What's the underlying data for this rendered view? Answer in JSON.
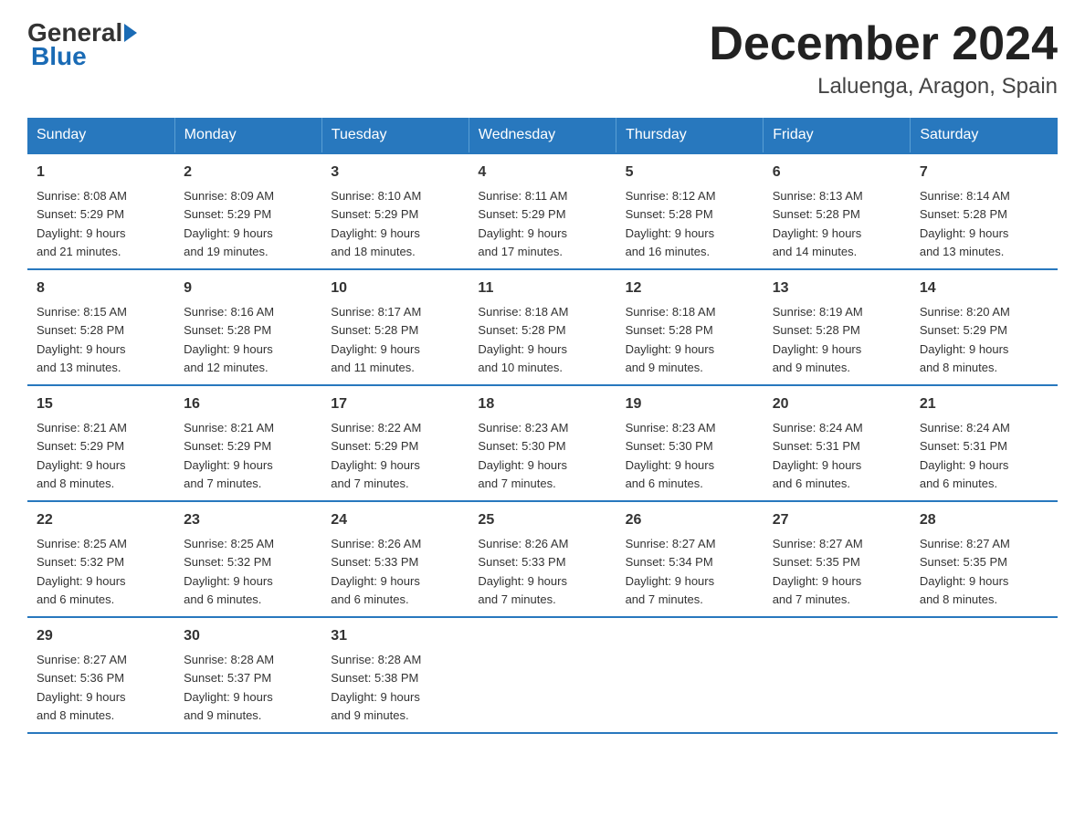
{
  "header": {
    "logo_general": "General",
    "logo_blue": "Blue",
    "month_title": "December 2024",
    "location": "Laluenga, Aragon, Spain"
  },
  "days_of_week": [
    "Sunday",
    "Monday",
    "Tuesday",
    "Wednesday",
    "Thursday",
    "Friday",
    "Saturday"
  ],
  "weeks": [
    [
      {
        "day": "1",
        "sunrise": "8:08 AM",
        "sunset": "5:29 PM",
        "daylight": "9 hours and 21 minutes."
      },
      {
        "day": "2",
        "sunrise": "8:09 AM",
        "sunset": "5:29 PM",
        "daylight": "9 hours and 19 minutes."
      },
      {
        "day": "3",
        "sunrise": "8:10 AM",
        "sunset": "5:29 PM",
        "daylight": "9 hours and 18 minutes."
      },
      {
        "day": "4",
        "sunrise": "8:11 AM",
        "sunset": "5:29 PM",
        "daylight": "9 hours and 17 minutes."
      },
      {
        "day": "5",
        "sunrise": "8:12 AM",
        "sunset": "5:28 PM",
        "daylight": "9 hours and 16 minutes."
      },
      {
        "day": "6",
        "sunrise": "8:13 AM",
        "sunset": "5:28 PM",
        "daylight": "9 hours and 14 minutes."
      },
      {
        "day": "7",
        "sunrise": "8:14 AM",
        "sunset": "5:28 PM",
        "daylight": "9 hours and 13 minutes."
      }
    ],
    [
      {
        "day": "8",
        "sunrise": "8:15 AM",
        "sunset": "5:28 PM",
        "daylight": "9 hours and 13 minutes."
      },
      {
        "day": "9",
        "sunrise": "8:16 AM",
        "sunset": "5:28 PM",
        "daylight": "9 hours and 12 minutes."
      },
      {
        "day": "10",
        "sunrise": "8:17 AM",
        "sunset": "5:28 PM",
        "daylight": "9 hours and 11 minutes."
      },
      {
        "day": "11",
        "sunrise": "8:18 AM",
        "sunset": "5:28 PM",
        "daylight": "9 hours and 10 minutes."
      },
      {
        "day": "12",
        "sunrise": "8:18 AM",
        "sunset": "5:28 PM",
        "daylight": "9 hours and 9 minutes."
      },
      {
        "day": "13",
        "sunrise": "8:19 AM",
        "sunset": "5:28 PM",
        "daylight": "9 hours and 9 minutes."
      },
      {
        "day": "14",
        "sunrise": "8:20 AM",
        "sunset": "5:29 PM",
        "daylight": "9 hours and 8 minutes."
      }
    ],
    [
      {
        "day": "15",
        "sunrise": "8:21 AM",
        "sunset": "5:29 PM",
        "daylight": "9 hours and 8 minutes."
      },
      {
        "day": "16",
        "sunrise": "8:21 AM",
        "sunset": "5:29 PM",
        "daylight": "9 hours and 7 minutes."
      },
      {
        "day": "17",
        "sunrise": "8:22 AM",
        "sunset": "5:29 PM",
        "daylight": "9 hours and 7 minutes."
      },
      {
        "day": "18",
        "sunrise": "8:23 AM",
        "sunset": "5:30 PM",
        "daylight": "9 hours and 7 minutes."
      },
      {
        "day": "19",
        "sunrise": "8:23 AM",
        "sunset": "5:30 PM",
        "daylight": "9 hours and 6 minutes."
      },
      {
        "day": "20",
        "sunrise": "8:24 AM",
        "sunset": "5:31 PM",
        "daylight": "9 hours and 6 minutes."
      },
      {
        "day": "21",
        "sunrise": "8:24 AM",
        "sunset": "5:31 PM",
        "daylight": "9 hours and 6 minutes."
      }
    ],
    [
      {
        "day": "22",
        "sunrise": "8:25 AM",
        "sunset": "5:32 PM",
        "daylight": "9 hours and 6 minutes."
      },
      {
        "day": "23",
        "sunrise": "8:25 AM",
        "sunset": "5:32 PM",
        "daylight": "9 hours and 6 minutes."
      },
      {
        "day": "24",
        "sunrise": "8:26 AM",
        "sunset": "5:33 PM",
        "daylight": "9 hours and 6 minutes."
      },
      {
        "day": "25",
        "sunrise": "8:26 AM",
        "sunset": "5:33 PM",
        "daylight": "9 hours and 7 minutes."
      },
      {
        "day": "26",
        "sunrise": "8:27 AM",
        "sunset": "5:34 PM",
        "daylight": "9 hours and 7 minutes."
      },
      {
        "day": "27",
        "sunrise": "8:27 AM",
        "sunset": "5:35 PM",
        "daylight": "9 hours and 7 minutes."
      },
      {
        "day": "28",
        "sunrise": "8:27 AM",
        "sunset": "5:35 PM",
        "daylight": "9 hours and 8 minutes."
      }
    ],
    [
      {
        "day": "29",
        "sunrise": "8:27 AM",
        "sunset": "5:36 PM",
        "daylight": "9 hours and 8 minutes."
      },
      {
        "day": "30",
        "sunrise": "8:28 AM",
        "sunset": "5:37 PM",
        "daylight": "9 hours and 9 minutes."
      },
      {
        "day": "31",
        "sunrise": "8:28 AM",
        "sunset": "5:38 PM",
        "daylight": "9 hours and 9 minutes."
      },
      null,
      null,
      null,
      null
    ]
  ],
  "labels": {
    "sunrise": "Sunrise:",
    "sunset": "Sunset:",
    "daylight": "Daylight:"
  }
}
